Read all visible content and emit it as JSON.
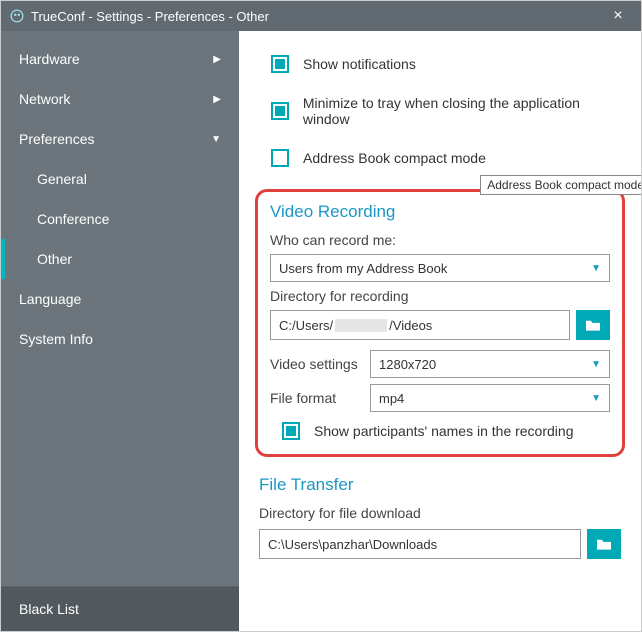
{
  "window": {
    "title": "TrueConf - Settings - Preferences - Other"
  },
  "sidebar": {
    "items": [
      {
        "label": "Hardware",
        "expandable": true
      },
      {
        "label": "Network",
        "expandable": true
      },
      {
        "label": "Preferences",
        "expandable": true,
        "expanded": true
      }
    ],
    "subitems": [
      {
        "label": "General"
      },
      {
        "label": "Conference"
      },
      {
        "label": "Other"
      }
    ],
    "tail": [
      {
        "label": "Language"
      },
      {
        "label": "System Info"
      }
    ],
    "bottom": {
      "label": "Black List"
    }
  },
  "checks": {
    "show_notifications": "Show notifications",
    "minimize_tray": "Minimize to tray when closing the application window",
    "ab_compact": "Address Book compact mode",
    "tooltip": "Address Book compact mode"
  },
  "video": {
    "title": "Video Recording",
    "who_label": "Who can record me:",
    "who_value": "Users from my Address Book",
    "dir_label": "Directory for recording",
    "dir_pre": "C:/Users/",
    "dir_post": "/Videos",
    "settings_label": "Video settings",
    "settings_value": "1280x720",
    "format_label": "File format",
    "format_value": "mp4",
    "show_names": "Show participants' names in the recording"
  },
  "filetransfer": {
    "title": "File Transfer",
    "dir_label": "Directory for file download",
    "dir_value": "C:\\Users\\panzhar\\Downloads"
  }
}
